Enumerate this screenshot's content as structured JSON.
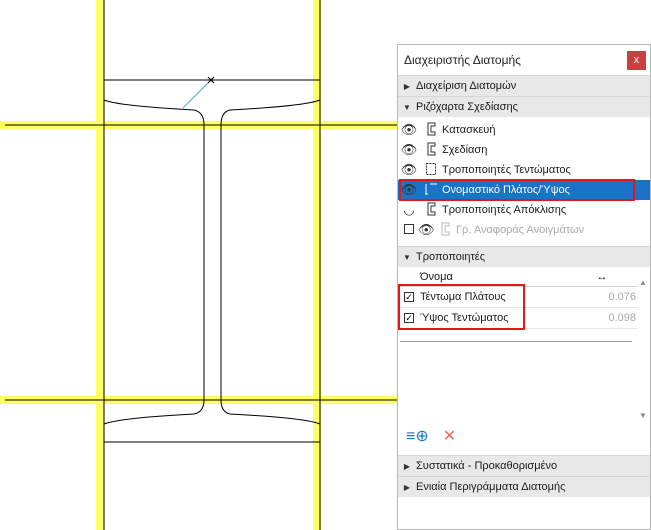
{
  "palette": {
    "title": "Διαχειριστής Διατομής",
    "close_label": "x",
    "sections": {
      "profile_management": "Διαχείριση Διατομών",
      "design_stretch": "Ριζόχαρτα Σχεδίασης",
      "modifiers": "Τροποποιητές",
      "components": "Συστατικά - Προκαθορισμένο",
      "unified_outlines": "Ενιαία Περιγράμματα Διατομής"
    },
    "layers": [
      {
        "label": "Κατασκευή",
        "selected": false,
        "dim": false
      },
      {
        "label": "Σχεδίαση",
        "selected": false,
        "dim": false
      },
      {
        "label": "Τροποποιητές Τεντώματος",
        "selected": false,
        "dim": false
      },
      {
        "label": "Ονομαστικό Πλάτος/Ύψος",
        "selected": true,
        "dim": false
      },
      {
        "label": "Τροποποιητές Απόκλισης",
        "selected": false,
        "dim": false
      },
      {
        "label": "Γρ. Αναφοράς Ανοιγμάτων",
        "selected": false,
        "dim": true
      }
    ],
    "table": {
      "col_name": "Όνομα",
      "col_value_icon": "stretch-width-icon",
      "rows": [
        {
          "name": "Τέντωμα Πλάτους",
          "value": "0.076",
          "checked": true
        },
        {
          "name": "Ύψος Τεντώματος",
          "value": "0.098",
          "checked": true
        }
      ]
    },
    "buttons": {
      "add_icon": "add-modifier-icon",
      "delete_icon": "delete-icon"
    },
    "colors": {
      "selection": "#1a73c8",
      "highlight_box": "#e01818",
      "close": "#c94040",
      "guide_line": "#ffff66"
    }
  }
}
